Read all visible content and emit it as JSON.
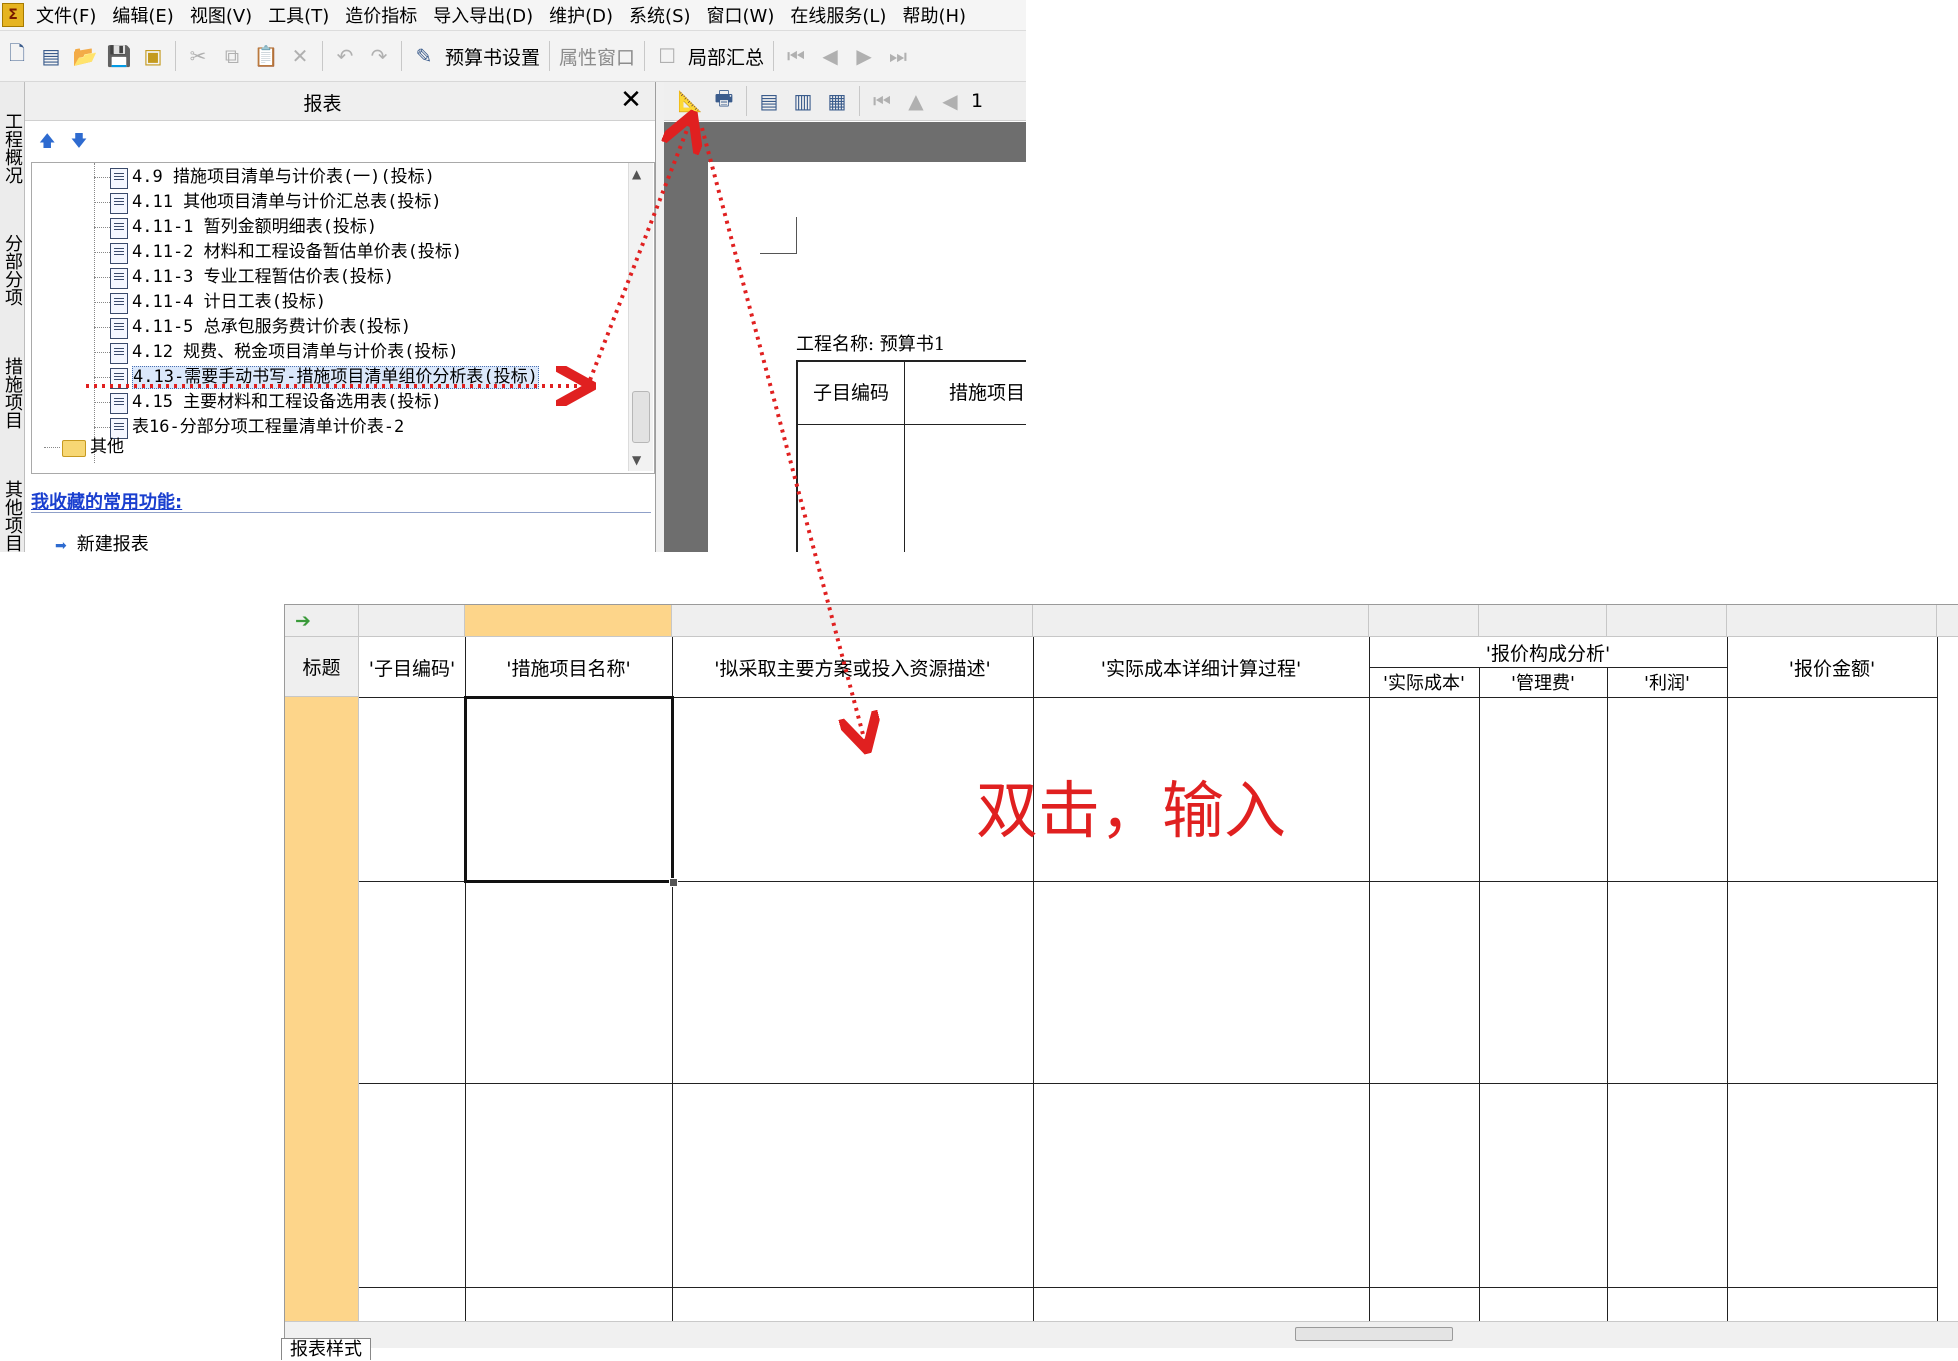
{
  "menubar": {
    "items": [
      "文件(F)",
      "编辑(E)",
      "视图(V)",
      "工具(T)",
      "造价指标",
      "导入导出(D)",
      "维护(D)",
      "系统(S)",
      "窗口(W)",
      "在线服务(L)",
      "帮助(H)"
    ]
  },
  "toolbar": {
    "budget_setting": "预算书设置",
    "property_window": "属性窗口",
    "partial_summary": "局部汇总"
  },
  "vertical_tabs": [
    "工程概况",
    "分部分项",
    "措施项目",
    "其他项目"
  ],
  "report_panel": {
    "title": "报表",
    "close": "✕",
    "tree_items": [
      "4.9 措施项目清单与计价表(一)(投标)",
      "4.11 其他项目清单与计价汇总表(投标)",
      "4.11-1 暂列金额明细表(投标)",
      "4.11-2 材料和工程设备暂估单价表(投标)",
      "4.11-3 专业工程暂估价表(投标)",
      "4.11-4 计日工表(投标)",
      "4.11-5 总承包服务费计价表(投标)",
      "4.12 规费、税金项目清单与计价表(投标)",
      "4.13-需要手动书写-措施项目清单组价分析表(投标)",
      "4.15 主要材料和工程设备选用表(投标)",
      "表16-分部分项工程量清单计价表-2"
    ],
    "selected_index": 8,
    "folder_other": "其他",
    "favorites_title": "我收藏的常用功能:",
    "favorites_item": "新建报表"
  },
  "preview": {
    "page_number": "1",
    "project_name": "工程名称: 预算书1",
    "col1": "子目编码",
    "col2": "措施项目"
  },
  "grid": {
    "title_label": "标题",
    "columns": {
      "code": "'子目编码'",
      "name": "'措施项目名称'",
      "plan": "'拟采取主要方案或投入资源描述'",
      "calc": "'实际成本详细计算过程'",
      "analysis": "'报价构成分析'",
      "cost": "'实际成本'",
      "mgmt": "'管理费'",
      "profit": "'利润'",
      "amount": "'报价金额'"
    },
    "sheet_tab": "报表样式"
  },
  "annotation": {
    "text": "双击，输入",
    "color": "#e02020"
  },
  "colors": {
    "header_selected": "#fdd58a",
    "accent_blue": "#1a3fcf"
  }
}
